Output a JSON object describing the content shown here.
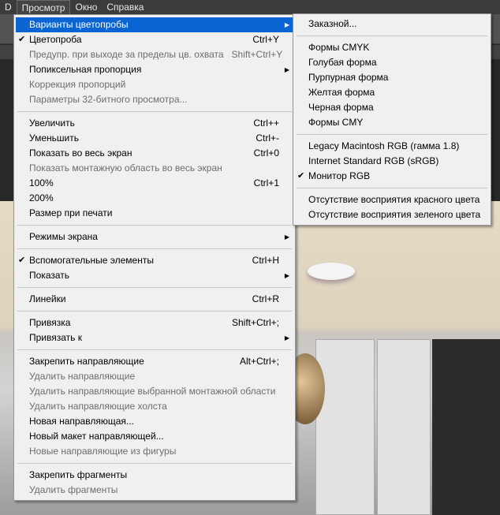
{
  "menubar": [
    "D",
    "Просмотр",
    "Окно",
    "Справка"
  ],
  "main": {
    "groups": [
      [
        {
          "label": "Варианты цветопробы",
          "submenu": true,
          "highlighted": true
        },
        {
          "label": "Цветопроба",
          "shortcut": "Ctrl+Y",
          "checked": true
        },
        {
          "label": "Предупр. при выходе за пределы цв. охвата",
          "shortcut": "Shift+Ctrl+Y",
          "disabled": true
        },
        {
          "label": "Попиксельная пропорция",
          "submenu": true
        },
        {
          "label": "Коррекция пропорций",
          "disabled": true
        },
        {
          "label": "Параметры 32-битного просмотра...",
          "disabled": true
        }
      ],
      [
        {
          "label": "Увеличить",
          "shortcut": "Ctrl++"
        },
        {
          "label": "Уменьшить",
          "shortcut": "Ctrl+-"
        },
        {
          "label": "Показать во весь экран",
          "shortcut": "Ctrl+0"
        },
        {
          "label": "Показать монтажную область во весь экран",
          "disabled": true
        },
        {
          "label": "100%",
          "shortcut": "Ctrl+1"
        },
        {
          "label": "200%"
        },
        {
          "label": "Размер при печати"
        }
      ],
      [
        {
          "label": "Режимы экрана",
          "submenu": true
        }
      ],
      [
        {
          "label": "Вспомогательные элементы",
          "shortcut": "Ctrl+H",
          "checked": true
        },
        {
          "label": "Показать",
          "submenu": true
        }
      ],
      [
        {
          "label": "Линейки",
          "shortcut": "Ctrl+R"
        }
      ],
      [
        {
          "label": "Привязка",
          "shortcut": "Shift+Ctrl+;"
        },
        {
          "label": "Привязать к",
          "submenu": true
        }
      ],
      [
        {
          "label": "Закрепить направляющие",
          "shortcut": "Alt+Ctrl+;"
        },
        {
          "label": "Удалить направляющие",
          "disabled": true
        },
        {
          "label": "Удалить направляющие выбранной монтажной области",
          "disabled": true
        },
        {
          "label": "Удалить направляющие холста",
          "disabled": true
        },
        {
          "label": "Новая направляющая..."
        },
        {
          "label": "Новый макет направляющей..."
        },
        {
          "label": "Новые направляющие из фигуры",
          "disabled": true
        }
      ],
      [
        {
          "label": "Закрепить фрагменты"
        },
        {
          "label": "Удалить фрагменты",
          "disabled": true
        }
      ]
    ]
  },
  "sub": {
    "groups": [
      [
        {
          "label": "Заказной..."
        }
      ],
      [
        {
          "label": "Формы CMYK"
        },
        {
          "label": "Голубая форма"
        },
        {
          "label": "Пурпурная форма"
        },
        {
          "label": "Желтая форма"
        },
        {
          "label": "Черная форма"
        },
        {
          "label": "Формы CMY"
        }
      ],
      [
        {
          "label": "Legacy Macintosh RGB (гамма 1.8)"
        },
        {
          "label": "Internet Standard RGB (sRGB)"
        },
        {
          "label": "Монитор RGB",
          "checked": true
        }
      ],
      [
        {
          "label": "Отсутствие восприятия красного цвета"
        },
        {
          "label": "Отсутствие восприятия зеленого цвета"
        }
      ]
    ]
  },
  "icons": {
    "check": "✔",
    "arrow": "▶"
  }
}
